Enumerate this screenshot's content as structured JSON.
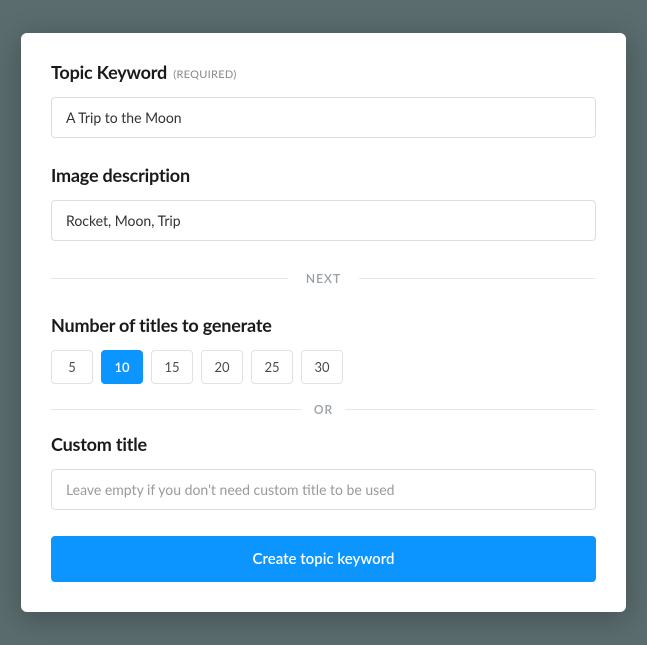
{
  "topic": {
    "label": "Topic Keyword",
    "required_tag": "(REQUIRED)",
    "value": "A Trip to the Moon"
  },
  "image_desc": {
    "label": "Image description",
    "value": "Rocket, Moon, Trip"
  },
  "divider_next": "NEXT",
  "titles_count": {
    "label": "Number of titles to generate",
    "options": [
      "5",
      "10",
      "15",
      "20",
      "25",
      "30"
    ],
    "selected": "10"
  },
  "divider_or": "OR",
  "custom_title": {
    "label": "Custom title",
    "placeholder": "Leave empty if you don't need custom title to be used",
    "value": ""
  },
  "submit_label": "Create topic keyword",
  "colors": {
    "accent": "#0c95ff",
    "page_bg": "#5a6c6e"
  }
}
